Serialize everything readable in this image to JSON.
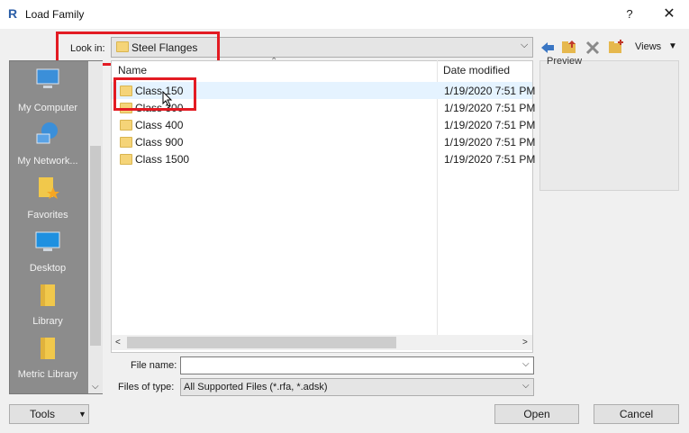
{
  "window": {
    "title": "Load Family",
    "app_icon_letter": "R",
    "help_label": "?",
    "close_label": "✕"
  },
  "lookin": {
    "label": "Look in:",
    "value": "Steel Flanges"
  },
  "toolbar": {
    "views_label": "Views",
    "icons": [
      "back-arrow-icon",
      "up-folder-icon",
      "delete-icon",
      "new-folder-icon"
    ]
  },
  "places": [
    {
      "label": "My Computer",
      "icon": "computer-icon"
    },
    {
      "label": "My Network...",
      "icon": "network-icon"
    },
    {
      "label": "Favorites",
      "icon": "favorites-icon"
    },
    {
      "label": "Desktop",
      "icon": "desktop-icon"
    },
    {
      "label": "Library",
      "icon": "library-icon"
    },
    {
      "label": "Metric Library",
      "icon": "metric-library-icon"
    }
  ],
  "filelist": {
    "columns": {
      "name": "Name",
      "date": "Date modified"
    },
    "rows": [
      {
        "name": "Class 150",
        "date": "1/19/2020 7:51 PM"
      },
      {
        "name": "Class 300",
        "date": "1/19/2020 7:51 PM"
      },
      {
        "name": "Class 400",
        "date": "1/19/2020 7:51 PM"
      },
      {
        "name": "Class 900",
        "date": "1/19/2020 7:51 PM"
      },
      {
        "name": "Class 1500",
        "date": "1/19/2020 7:51 PM"
      }
    ]
  },
  "preview": {
    "label": "Preview"
  },
  "filename": {
    "label": "File name:",
    "value": ""
  },
  "filetype": {
    "label": "Files of type:",
    "value": "All Supported Files  (*.rfa, *.adsk)"
  },
  "buttons": {
    "tools": "Tools",
    "open": "Open",
    "cancel": "Cancel"
  },
  "colors": {
    "highlight": "#e31b23",
    "folder": "#f5d478"
  }
}
